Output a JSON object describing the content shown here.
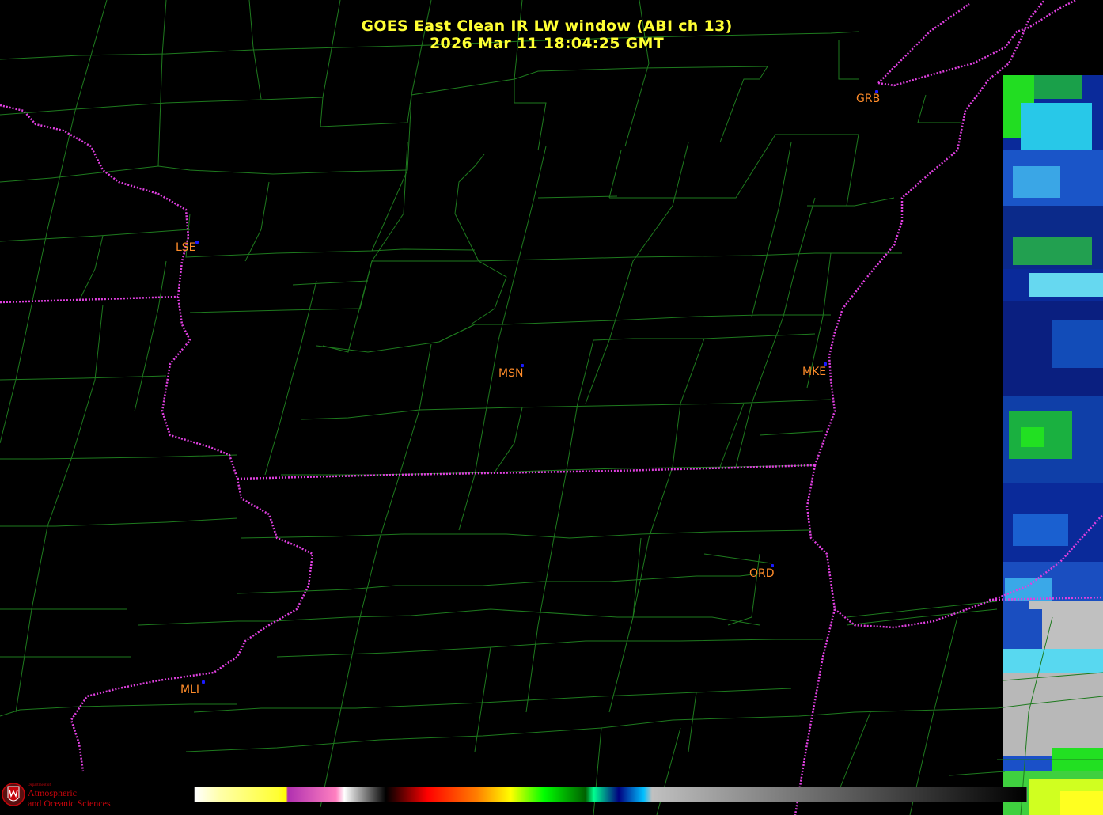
{
  "title": {
    "line1": "GOES East Clean IR LW window (ABI ch 13)",
    "line2": "2026 Mar 11  18:04:25 GMT"
  },
  "cities": [
    {
      "code": "GRB"
    },
    {
      "code": "LSE"
    },
    {
      "code": "MSN"
    },
    {
      "code": "MKE"
    },
    {
      "code": "ORD"
    },
    {
      "code": "MLI"
    }
  ],
  "colors": {
    "county_lines": "#1e7a1e",
    "state_borders": "#e040e0",
    "city_labels": "#ff8c2a",
    "title": "#ffff33"
  },
  "logo": {
    "dept_label": "Department of",
    "line1": "Atmospheric",
    "line2": "and Oceanic Sciences"
  },
  "colorbar": {
    "stops": [
      "#ffffff",
      "#ffffaa",
      "#ffff33",
      "#ffff00",
      "#b030b0",
      "#ff80c0",
      "#ffffff",
      "#000000",
      "#300000",
      "#ff0000",
      "#ff8000",
      "#ffff00",
      "#00ff00",
      "#006000",
      "#00ff90",
      "#000080",
      "#00c0ff",
      "#c0c0c0",
      "#000000"
    ]
  }
}
